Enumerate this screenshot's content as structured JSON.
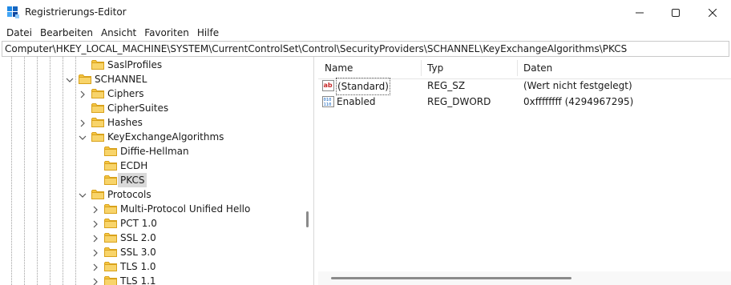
{
  "window": {
    "title": "Registrierungs-Editor",
    "controls": {
      "minimize": "minimize-icon",
      "maximize": "maximize-icon",
      "close": "close-icon"
    }
  },
  "menu": [
    "Datei",
    "Bearbeiten",
    "Ansicht",
    "Favoriten",
    "Hilfe"
  ],
  "address": "Computer\\HKEY_LOCAL_MACHINE\\SYSTEM\\CurrentControlSet\\Control\\SecurityProviders\\SCHANNEL\\KeyExchangeAlgorithms\\PKCS",
  "tree": [
    {
      "label": "SaslProfiles",
      "chevron": "none",
      "selected": false
    },
    {
      "label": "SCHANNEL",
      "chevron": "down",
      "selected": false
    },
    {
      "label": "Ciphers",
      "chevron": "right",
      "selected": false
    },
    {
      "label": "CipherSuites",
      "chevron": "none",
      "selected": false
    },
    {
      "label": "Hashes",
      "chevron": "right",
      "selected": false
    },
    {
      "label": "KeyExchangeAlgorithms",
      "chevron": "down",
      "selected": false
    },
    {
      "label": "Diffie-Hellman",
      "chevron": "none",
      "selected": false
    },
    {
      "label": "ECDH",
      "chevron": "none",
      "selected": false
    },
    {
      "label": "PKCS",
      "chevron": "none",
      "selected": true
    },
    {
      "label": "Protocols",
      "chevron": "down",
      "selected": false
    },
    {
      "label": "Multi-Protocol Unified Hello",
      "chevron": "right",
      "selected": false
    },
    {
      "label": "PCT 1.0",
      "chevron": "right",
      "selected": false
    },
    {
      "label": "SSL 2.0",
      "chevron": "right",
      "selected": false
    },
    {
      "label": "SSL 3.0",
      "chevron": "right",
      "selected": false
    },
    {
      "label": "TLS 1.0",
      "chevron": "right",
      "selected": false
    },
    {
      "label": "TLS 1.1",
      "chevron": "right",
      "selected": false
    }
  ],
  "list": {
    "columns": {
      "name": "Name",
      "type": "Typ",
      "data": "Daten"
    },
    "rows": [
      {
        "name": "(Standard)",
        "type": "REG_SZ",
        "data": "(Wert nicht festgelegt)",
        "icon": "string-value-icon"
      },
      {
        "name": "Enabled",
        "type": "REG_DWORD",
        "data": "0xffffffff (4294967295)",
        "icon": "binary-value-icon"
      }
    ]
  },
  "colors": {
    "folder": "#f5c542",
    "selection": "#d9d9d9",
    "accent": "#0067c0"
  }
}
